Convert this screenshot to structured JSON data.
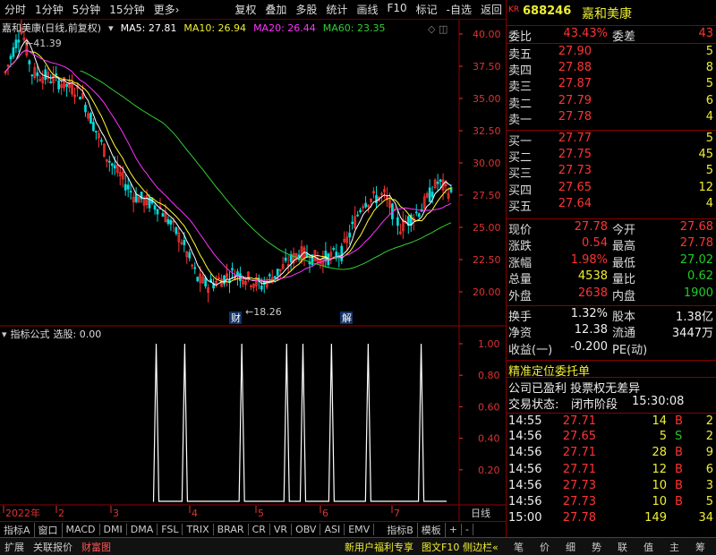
{
  "toolbar": {
    "left_items": [
      "分时",
      "1分钟",
      "5分钟",
      "15分钟",
      "更多›"
    ],
    "right_items": [
      "复权",
      "叠加",
      "多股",
      "统计",
      "画线",
      "F10",
      "标记",
      "-自选",
      "返回"
    ]
  },
  "chart_header": {
    "stock_name": "嘉和美康(日线,前复权)",
    "ma5": "MA5: 27.81",
    "ma10": "MA10: 26.94",
    "ma20": "MA20: 26.44",
    "ma60": "MA60: 23.35",
    "high_marker": "41.39",
    "low_marker": "18.26",
    "event_cai": "财",
    "event_jie": "解"
  },
  "colors": {
    "up": "#ff3333",
    "down": "#00dddd",
    "ma5": "#ffffff",
    "ma10": "#ffff33",
    "ma20": "#ff33ff",
    "ma60": "#33cc33"
  },
  "price_axis": [
    "40.00",
    "37.50",
    "35.00",
    "32.50",
    "30.00",
    "27.50",
    "25.00",
    "22.50",
    "20.00"
  ],
  "indicator": {
    "title": "指标公式",
    "subtitle": "选股: 0.00",
    "axis": [
      "1.00",
      "0.80",
      "0.60",
      "0.40",
      "0.20"
    ],
    "signal_days": [
      37,
      44,
      58,
      69,
      73,
      80,
      89,
      102
    ]
  },
  "date_axis": [
    "2022年",
    "2",
    "3",
    "4",
    "5",
    "6",
    "7"
  ],
  "date_axis_right": "日线",
  "bottom_tabs": [
    "指标A",
    "窗口",
    "MACD",
    "DMI",
    "DMA",
    "FSL",
    "TRIX",
    "BRAR",
    "CR",
    "VR",
    "OBV",
    "ASI",
    "EMV",
    "指标B",
    "模板",
    "+",
    "-"
  ],
  "status_bar": {
    "left": [
      "扩展",
      "关联报价",
      "财富图"
    ],
    "middle": [
      "新用户福利专享",
      "图文F10",
      "侧边栏«"
    ],
    "icons": [
      "笔",
      "价",
      "细",
      "势",
      "联",
      "值",
      "主",
      "筹"
    ]
  },
  "quote": {
    "market": "KR",
    "code": "688246",
    "name": "嘉和美康",
    "weibi_label": "委比",
    "weibi": "43.43%",
    "weicha_label": "委差",
    "weicha": "43",
    "asks": [
      {
        "label": "卖五",
        "price": "27.90",
        "vol": "5"
      },
      {
        "label": "卖四",
        "price": "27.88",
        "vol": "8"
      },
      {
        "label": "卖三",
        "price": "27.87",
        "vol": "5"
      },
      {
        "label": "卖二",
        "price": "27.79",
        "vol": "6"
      },
      {
        "label": "卖一",
        "price": "27.78",
        "vol": "4"
      }
    ],
    "bids": [
      {
        "label": "买一",
        "price": "27.77",
        "vol": "5"
      },
      {
        "label": "买二",
        "price": "27.75",
        "vol": "45"
      },
      {
        "label": "买三",
        "price": "27.73",
        "vol": "5"
      },
      {
        "label": "买四",
        "price": "27.65",
        "vol": "12"
      },
      {
        "label": "买五",
        "price": "27.64",
        "vol": "4"
      }
    ],
    "stats": [
      {
        "l1": "现价",
        "v1": "27.78",
        "c1": "red",
        "l2": "今开",
        "v2": "27.68",
        "c2": "red"
      },
      {
        "l1": "涨跌",
        "v1": "0.54",
        "c1": "red",
        "l2": "最高",
        "v2": "27.78",
        "c2": "red"
      },
      {
        "l1": "涨幅",
        "v1": "1.98%",
        "c1": "red",
        "l2": "最低",
        "v2": "27.02",
        "c2": "grn"
      },
      {
        "l1": "总量",
        "v1": "4538",
        "c1": "yel",
        "l2": "量比",
        "v2": "0.62",
        "c2": "grn"
      },
      {
        "l1": "外盘",
        "v1": "2638",
        "c1": "red",
        "l2": "内盘",
        "v2": "1900",
        "c2": "grn"
      }
    ],
    "stats2": [
      {
        "l1": "换手",
        "v1": "1.32%",
        "l2": "股本",
        "v2": "1.38亿"
      },
      {
        "l1": "净资",
        "v1": "12.38",
        "l2": "流通",
        "v2": "3447万"
      },
      {
        "l1": "收益(一)",
        "v1": "-0.200",
        "l2": "PE(动)",
        "v2": ""
      }
    ],
    "promo": "精准定位委托单",
    "notes": [
      "公司已盈利 投票权无差异"
    ],
    "trade_status_label": "交易状态:",
    "trade_status": "闭市阶段",
    "trade_time": "15:30:08",
    "ticks": [
      {
        "time": "14:55",
        "price": "27.71",
        "vol": "14",
        "bs": "B",
        "n": "2"
      },
      {
        "time": "14:56",
        "price": "27.65",
        "vol": "5",
        "bs": "S",
        "n": "2"
      },
      {
        "time": "14:56",
        "price": "27.71",
        "vol": "28",
        "bs": "B",
        "n": "9"
      },
      {
        "time": "14:56",
        "price": "27.71",
        "vol": "12",
        "bs": "B",
        "n": "6"
      },
      {
        "time": "14:56",
        "price": "27.73",
        "vol": "10",
        "bs": "B",
        "n": "3"
      },
      {
        "time": "14:56",
        "price": "27.73",
        "vol": "10",
        "bs": "B",
        "n": "5"
      },
      {
        "time": "15:00",
        "price": "27.78",
        "vol": "149",
        "bs": "",
        "n": "34"
      }
    ]
  }
}
